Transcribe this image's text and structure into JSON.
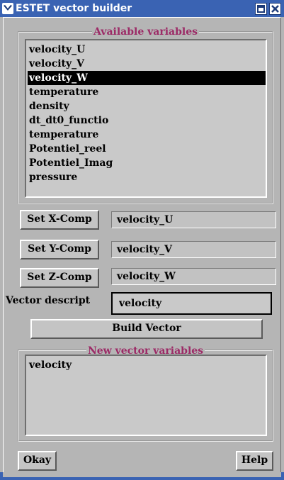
{
  "window": {
    "title": "ESTET vector builder"
  },
  "available_group": {
    "title": "Available variables",
    "items": [
      "velocity_U",
      "velocity_V",
      "velocity_W",
      "temperature",
      "density",
      "dt_dt0_functio",
      "temperature",
      "Potentiel_reel",
      "Potentiel_Imag",
      "pressure"
    ],
    "selected": "velocity_W"
  },
  "components": [
    {
      "button": "Set X-Comp",
      "value": "velocity_U"
    },
    {
      "button": "Set Y-Comp",
      "value": "velocity_V"
    },
    {
      "button": "Set Z-Comp",
      "value": "velocity_W"
    }
  ],
  "description": {
    "label": "Vector descript",
    "value": "velocity"
  },
  "build_button": "Build Vector",
  "new_group": {
    "title": "New vector variables",
    "items": [
      "velocity"
    ]
  },
  "footer": {
    "okay": "Okay",
    "help": "Help"
  }
}
